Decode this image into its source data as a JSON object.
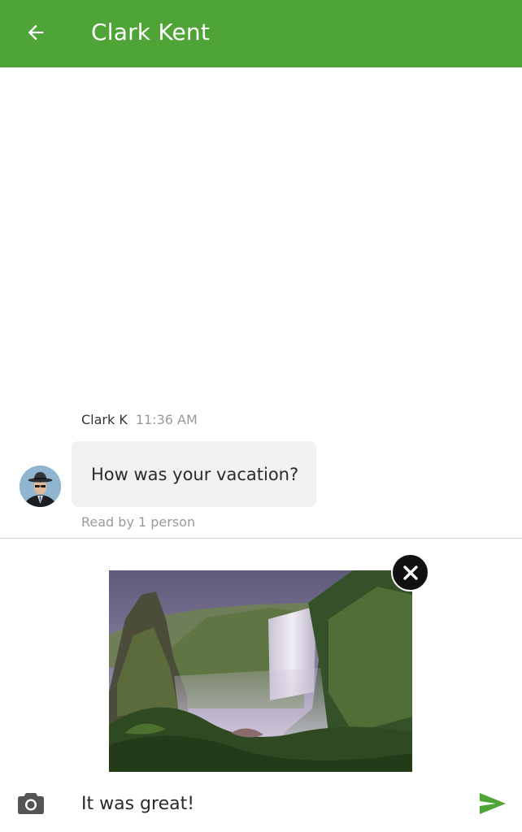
{
  "header": {
    "title": "Clark Kent",
    "back_icon": "arrow-left-icon",
    "background_color": "#4ea437"
  },
  "conversation": {
    "messages": [
      {
        "sender": "Clark K",
        "time": "11:36 AM",
        "text": "How was your vacation?",
        "read_receipt": "Read by 1 person",
        "avatar_icon": "man-in-hat-avatar"
      }
    ]
  },
  "composer": {
    "attachment": {
      "type": "image",
      "subject": "waterfall-landscape",
      "remove_icon": "close-icon"
    },
    "camera_icon": "camera-icon",
    "input_value": "It was great!",
    "send_icon": "send-icon",
    "accent_color": "#4ea437"
  }
}
